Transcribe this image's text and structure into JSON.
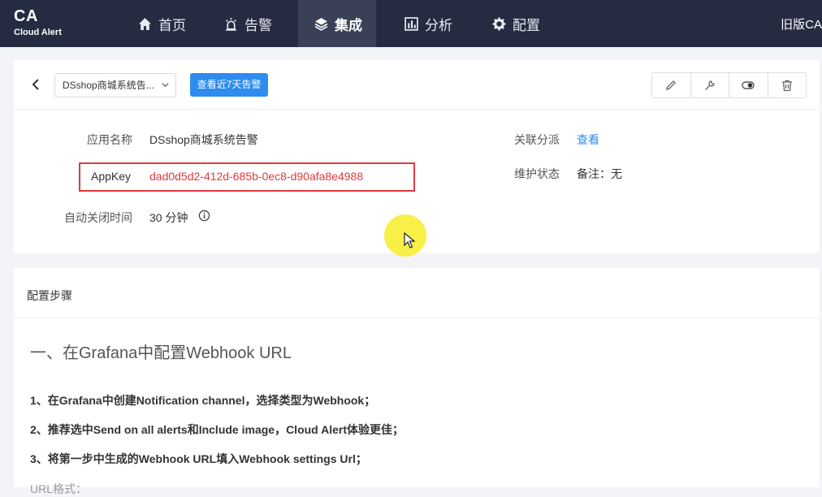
{
  "brand": {
    "short": "CA",
    "full": "Cloud Alert"
  },
  "nav": [
    {
      "label": "首页",
      "icon": "home-icon"
    },
    {
      "label": "告警",
      "icon": "alarm-light-icon"
    },
    {
      "label": "集成",
      "icon": "layers-icon",
      "active": true
    },
    {
      "label": "分析",
      "icon": "bar-chart-icon"
    },
    {
      "label": "配置",
      "icon": "gear-icon"
    }
  ],
  "old_version_link": "旧版CA",
  "toolbar": {
    "app_selected": "DSshop商城系统告...",
    "recent_alerts_button": "查看近7天告警",
    "tools": [
      "edit-icon",
      "wrench-icon",
      "toggle-icon",
      "trash-icon"
    ]
  },
  "details": {
    "app_name_label": "应用名称",
    "app_name_value": "DSshop商城系统告警",
    "appkey_label": "AppKey",
    "appkey_value": "dad0d5d2-412d-685b-0ec8-d90afa8e4988",
    "auto_close_label": "自动关闭时间",
    "auto_close_value": "30 分钟",
    "dispatch_label": "关联分派",
    "dispatch_link": "查看",
    "maintenance_label": "维护状态",
    "maintenance_value": "备注：无"
  },
  "steps": {
    "title": "配置步骤",
    "section_heading": "一、在Grafana中配置Webhook URL",
    "items": [
      "1、在Grafana中创建Notification channel，选择类型为Webhook；",
      "2、推荐选中Send on all alerts和Include image，Cloud Alert体验更佳；",
      "3、将第一步中生成的Webhook URL填入Webhook settings Url；"
    ],
    "url_format_label": "URL格式："
  },
  "colors": {
    "nav_bg": "#252c42",
    "primary": "#2d8cf0",
    "highlight": "#e2383d"
  }
}
